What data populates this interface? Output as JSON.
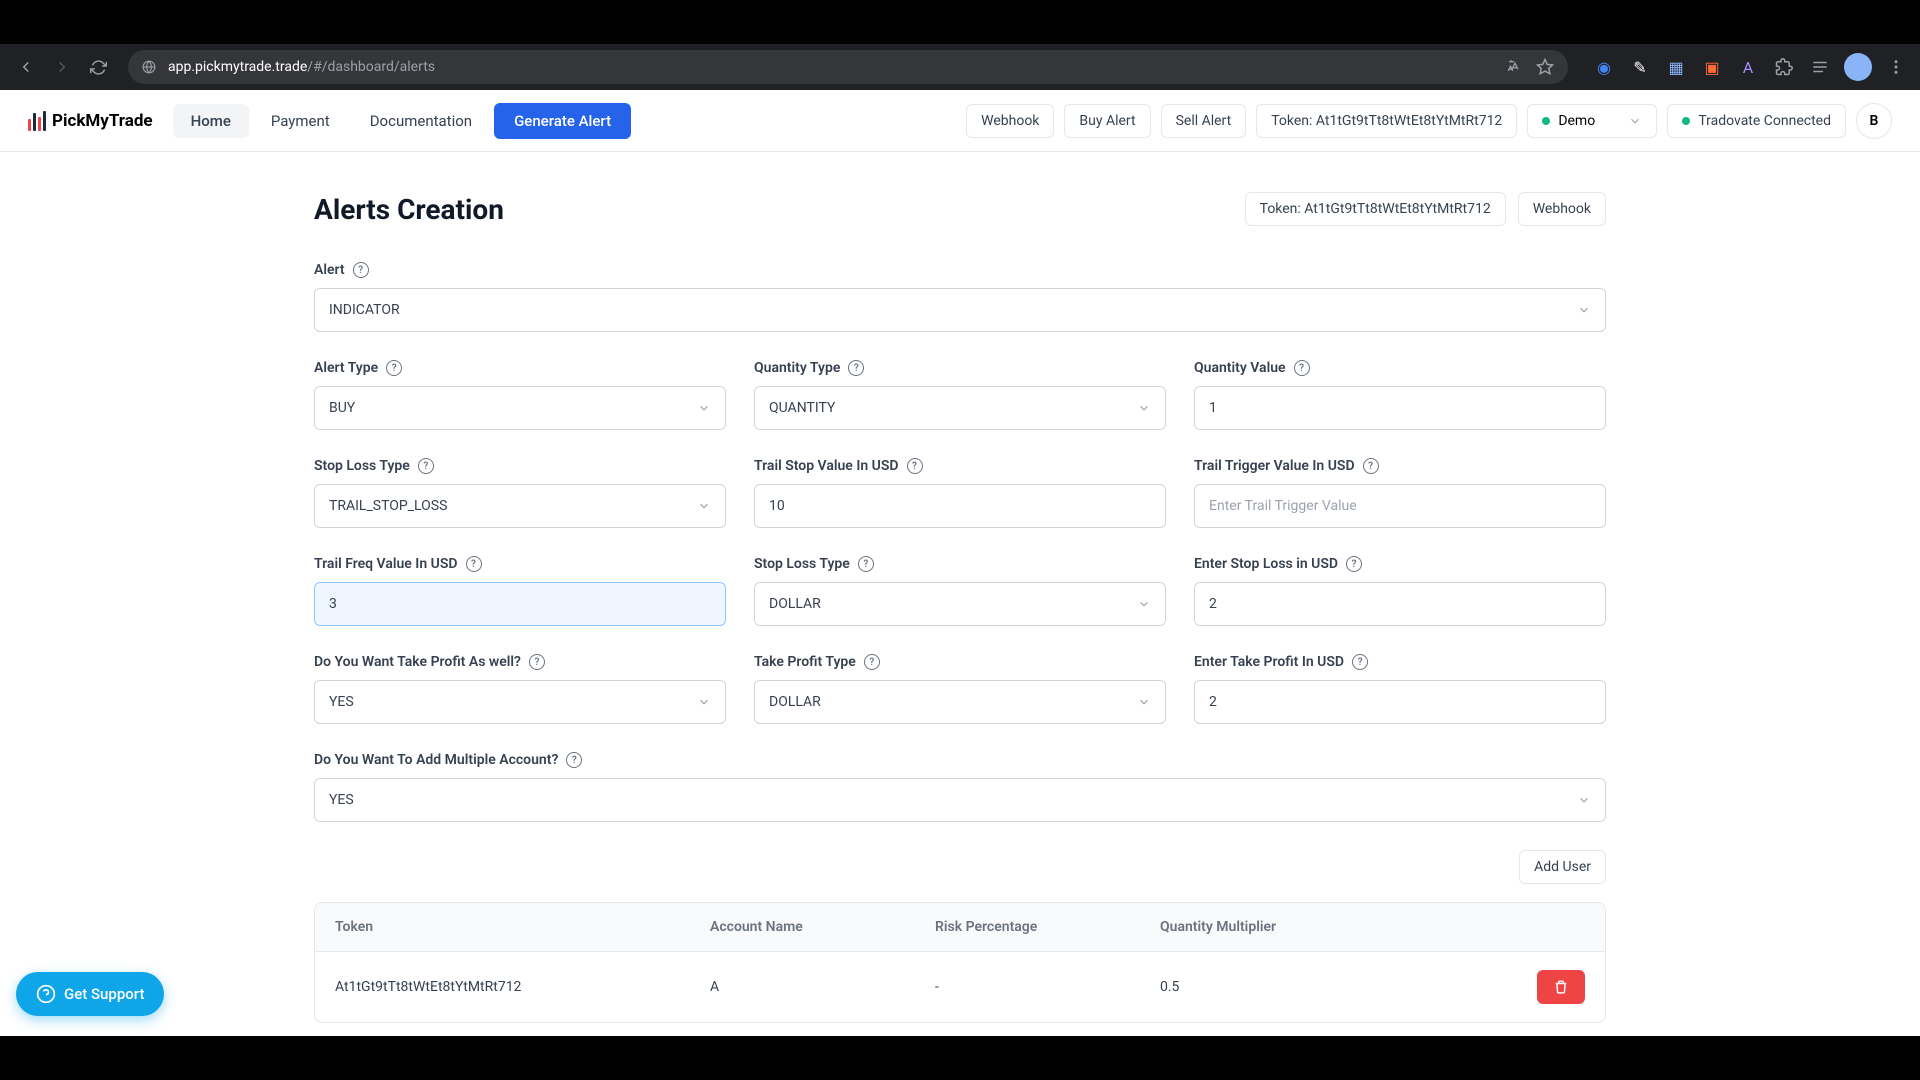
{
  "browser": {
    "url_host": "app.pickmytrade.trade",
    "url_path": "/#/dashboard/alerts"
  },
  "nav": {
    "brand": "PickMyTrade",
    "items": [
      "Home",
      "Payment",
      "Documentation"
    ],
    "generate": "Generate Alert",
    "webhook": "Webhook",
    "buy_alert": "Buy Alert",
    "sell_alert": "Sell Alert",
    "token_label": "Token: At1tGt9tTt8tWtEt8tYtMtRt712",
    "account": "Demo",
    "connection": "Tradovate Connected",
    "avatar": "B"
  },
  "page": {
    "title": "Alerts Creation",
    "token_chip": "Token: At1tGt9tTt8tWtEt8tYtMtRt712",
    "webhook_chip": "Webhook"
  },
  "form": {
    "alert": {
      "label": "Alert",
      "value": "INDICATOR"
    },
    "alert_type": {
      "label": "Alert Type",
      "value": "BUY"
    },
    "quantity_type": {
      "label": "Quantity Type",
      "value": "QUANTITY"
    },
    "quantity_value": {
      "label": "Quantity Value",
      "value": "1"
    },
    "stop_loss_type": {
      "label": "Stop Loss Type",
      "value": "TRAIL_STOP_LOSS"
    },
    "trail_stop_value": {
      "label": "Trail Stop Value In USD",
      "value": "10"
    },
    "trail_trigger": {
      "label": "Trail Trigger Value In USD",
      "placeholder": "Enter Trail Trigger Value"
    },
    "trail_freq": {
      "label": "Trail Freq Value In USD",
      "value": "3"
    },
    "stop_loss_type2": {
      "label": "Stop Loss Type",
      "value": "DOLLAR"
    },
    "stop_loss_usd": {
      "label": "Enter Stop Loss in USD",
      "value": "2"
    },
    "want_tp": {
      "label": "Do You Want Take Profit As well?",
      "value": "YES"
    },
    "tp_type": {
      "label": "Take Profit Type",
      "value": "DOLLAR"
    },
    "tp_usd": {
      "label": "Enter Take Profit In USD",
      "value": "2"
    },
    "multi_account": {
      "label": "Do You Want To Add Multiple Account?",
      "value": "YES"
    },
    "add_user": "Add User"
  },
  "table": {
    "headers": {
      "token": "Token",
      "account": "Account Name",
      "risk": "Risk Percentage",
      "qty": "Quantity Multiplier"
    },
    "rows": [
      {
        "token": "At1tGt9tTt8tWtEt8tYtMtRt712",
        "account": "A",
        "risk": "-",
        "qty": "0.5"
      }
    ]
  },
  "support": "Get Support"
}
